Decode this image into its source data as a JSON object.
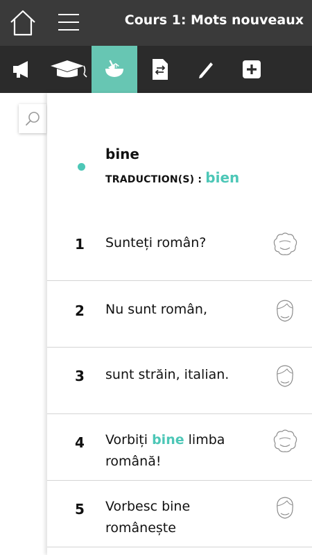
{
  "header": {
    "title": "Cours 1: Mots nouveaux"
  },
  "toolbar": {
    "tools": [
      {
        "icon": "speaker-icon"
      },
      {
        "icon": "graduation-cap-icon"
      },
      {
        "icon": "hand-book-icon",
        "active": true
      },
      {
        "icon": "document-swap-icon"
      },
      {
        "icon": "pencil-icon"
      },
      {
        "icon": "plus-square-icon"
      }
    ],
    "active_color": "#67c6b3"
  },
  "search": {
    "icon": "search-icon"
  },
  "word": {
    "term": "bine",
    "translation_label": "TRADUCTION(S) :",
    "translation": "bien",
    "accent_color": "#4dc7b7"
  },
  "lines": [
    {
      "num": "1",
      "text": "Sunteți român?",
      "speaker": "curly-hair-speaker-icon"
    },
    {
      "num": "2",
      "text": "Nu sunt român,",
      "speaker": "short-hair-speaker-icon"
    },
    {
      "num": "3",
      "text": "sunt străin, italian.",
      "speaker": "short-hair-speaker-icon"
    },
    {
      "num": "4",
      "pre": "Vorbiți ",
      "hl": "bine",
      "post": " limba română!",
      "speaker": "curly-hair-speaker-icon"
    },
    {
      "num": "5",
      "text": "Vorbesc bine românește",
      "speaker": "short-hair-speaker-icon"
    }
  ]
}
